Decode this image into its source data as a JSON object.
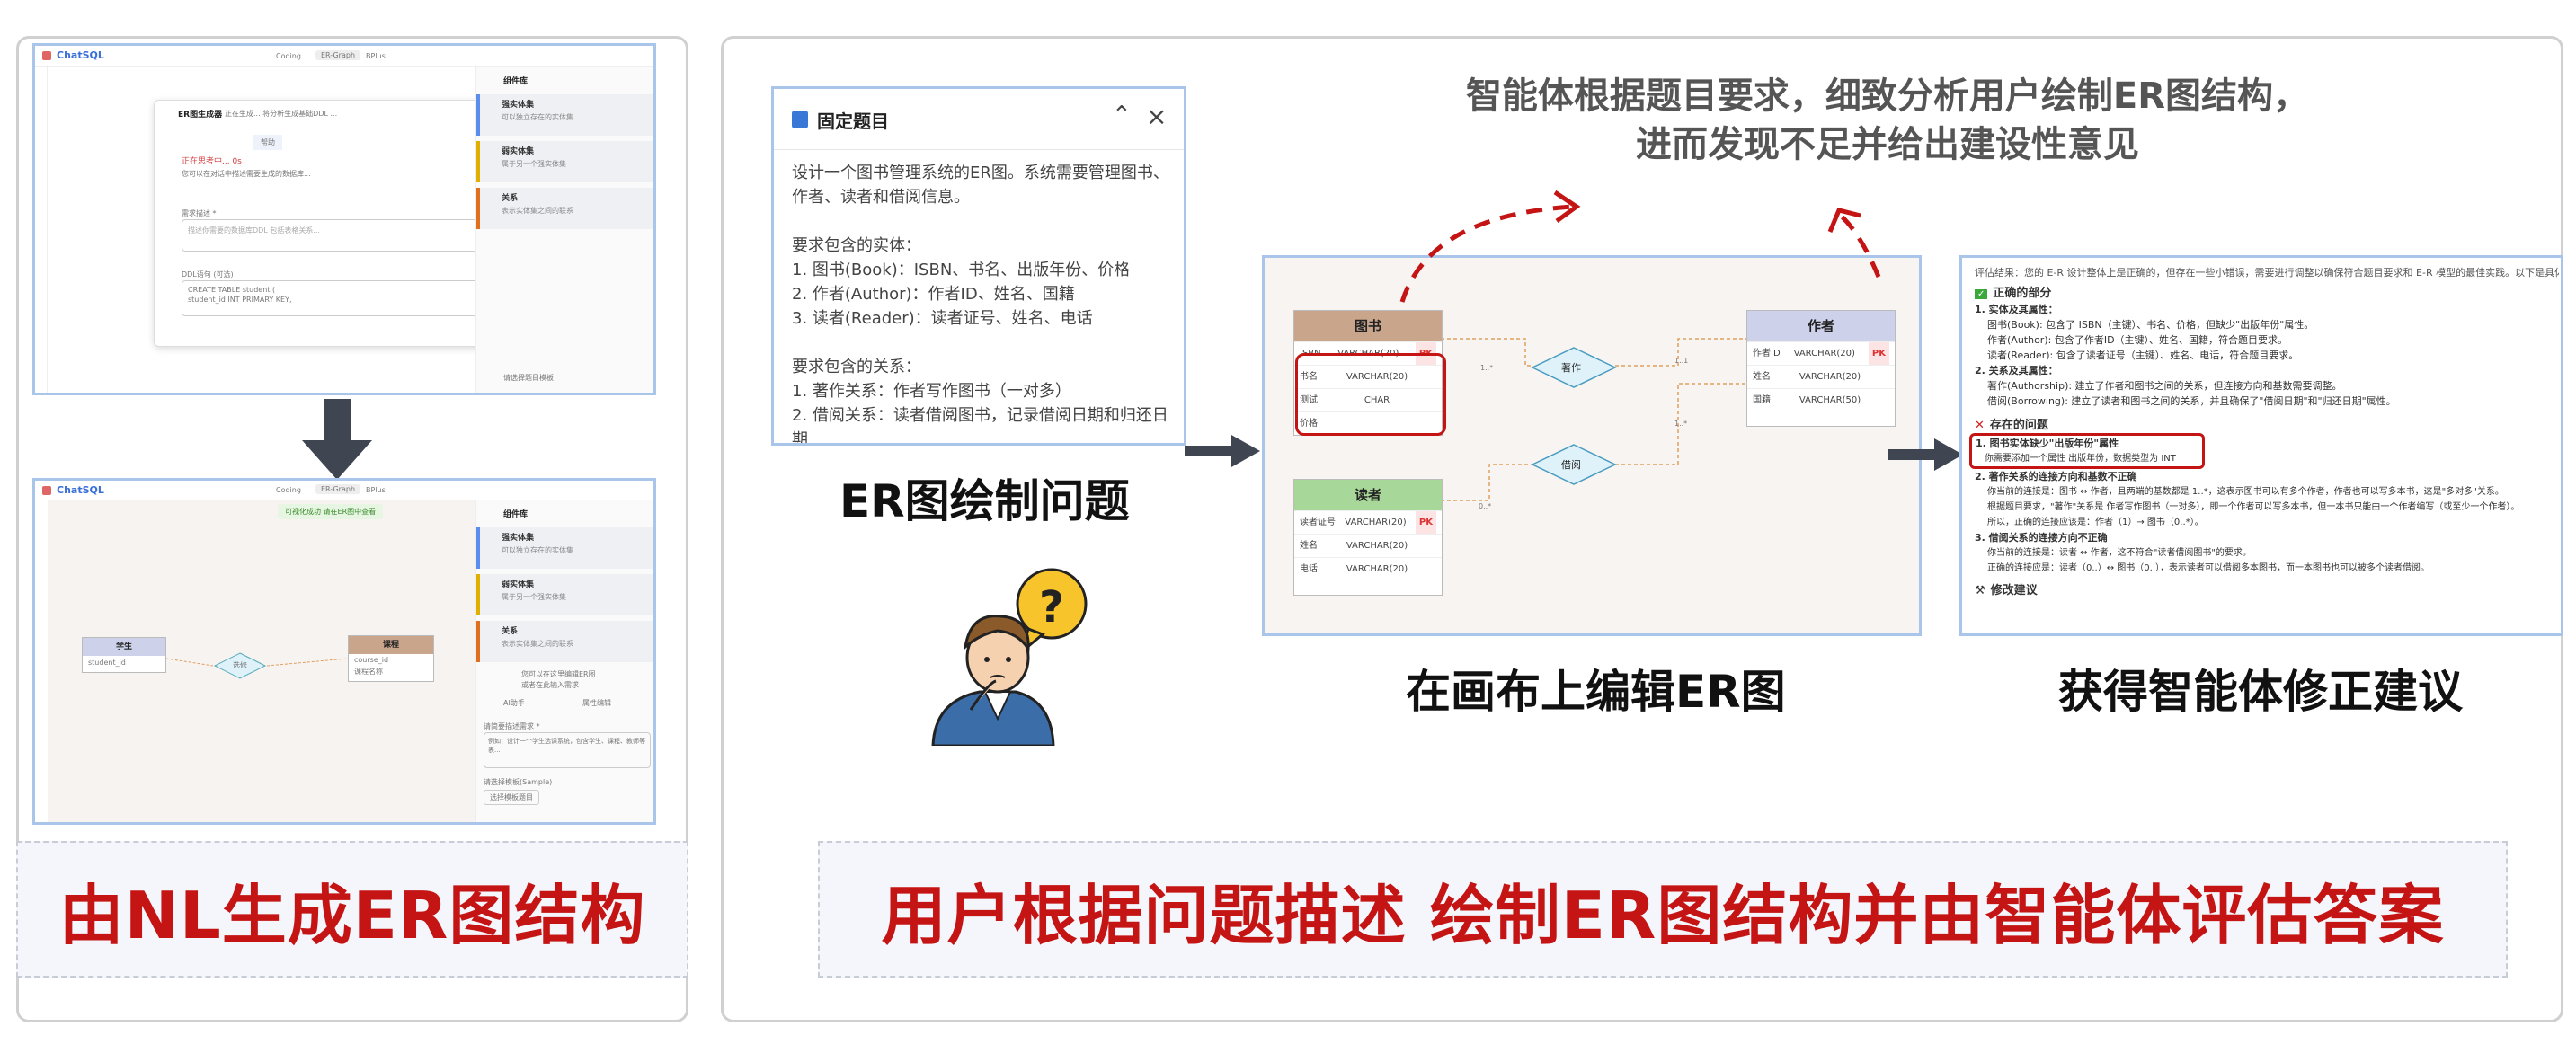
{
  "left_panel": {
    "top_shot": {
      "app_name": "ChatSQL",
      "tabs": [
        "Coding",
        "ER-Graph",
        "BPlus"
      ],
      "dialog_title": "ER图生成器",
      "dialog_sub": "正在生成... 将分析生成基础DDL ...",
      "msg_1": "帮助",
      "status": "正在思考中... 0s",
      "status_sub": "您可以在对话中描述需要生成的数据库...",
      "req_label": "需求描述 *",
      "req_placeholder": "描述你需要的数据库DDL 包括表格关系...",
      "ddl_label": "DDL语句 (可选)",
      "ddl_text": "CREATE TABLE student (",
      "ddl_text2": "  student_id INT PRIMARY KEY,",
      "panel_title": "组件库",
      "side_items": [
        {
          "title": "强实体集",
          "desc": "可以独立存在的实体集"
        },
        {
          "title": "弱实体集",
          "desc": "属于另一个强实体集"
        },
        {
          "title": "关系",
          "desc": "表示实体集之间的联系"
        }
      ],
      "side_bottom": "请选择题目模板"
    },
    "bottom_shot": {
      "app_name": "ChatSQL",
      "tabs": [
        "Coding",
        "ER-Graph",
        "BPlus"
      ],
      "toast": "可视化成功 请在ER图中查看",
      "entity_left": "学生",
      "entity_left_row": "student_id",
      "entity_right": "课程",
      "entity_right_rows": [
        "course_id",
        "课程名称"
      ],
      "relation": "选修",
      "panel_title": "组件库",
      "side_items": [
        {
          "title": "强实体集",
          "desc": "可以独立存在的实体集"
        },
        {
          "title": "弱实体集",
          "desc": "属于另一个强实体集"
        },
        {
          "title": "关系",
          "desc": "表示实体集之间的联系"
        }
      ],
      "hint_1": "您可以在这里编辑ER图",
      "hint_2": "或者在此输入需求",
      "tab_a": "AI助手",
      "tab_b": "属性编辑",
      "req_label": "请简要描述需求 *",
      "req_text": "例如：设计一个学生选课系统，包含学生、课程、教师等表...",
      "example_label": "请选择模板(Sample)",
      "example_btn": "选择模板题目"
    },
    "caption": "由NL生成ER图结构"
  },
  "right_panel": {
    "question_card": {
      "title": "固定题目",
      "paragraph_1": "设计一个图书管理系统的ER图。系统需要管理图书、作者、读者和借阅信息。",
      "entities_header": "要求包含的实体：",
      "entities": [
        "1. 图书(Book)：ISBN、书名、出版年份、价格",
        "2. 作者(Author)：作者ID、姓名、国籍",
        "3. 读者(Reader)：读者证号、姓名、电话"
      ],
      "relations_header": "要求包含的关系：",
      "relations": [
        "1. 著作关系：作者写作图书（一对多）",
        "2. 借阅关系：读者借阅图书，记录借阅日期和归还日期"
      ]
    },
    "question_caption": "ER图绘制问题",
    "canvas": {
      "book": {
        "name": "图书",
        "rows": [
          [
            "ISBN",
            "VARCHAR(20)",
            "PK"
          ],
          [
            "书名",
            "VARCHAR(20)",
            ""
          ],
          [
            "测试",
            "CHAR",
            ""
          ],
          [
            "价格",
            "",
            ""
          ]
        ]
      },
      "author": {
        "name": "作者",
        "rows": [
          [
            "作者ID",
            "VARCHAR(20)",
            "PK"
          ],
          [
            "姓名",
            "VARCHAR(20)",
            ""
          ],
          [
            "国籍",
            "VARCHAR(50)",
            ""
          ]
        ]
      },
      "reader": {
        "name": "读者",
        "rows": [
          [
            "读者证号",
            "VARCHAR(20)",
            "PK"
          ],
          [
            "姓名",
            "VARCHAR(20)",
            ""
          ],
          [
            "电话",
            "VARCHAR(20)",
            ""
          ]
        ]
      },
      "rel_write": "著作",
      "rel_borrow": "借阅",
      "card_1": "1..*",
      "card_2": "1..1",
      "card_3": "0..*",
      "card_4": "1..*"
    },
    "canvas_caption": "在画布上编辑ER图",
    "top_note_line1": "智能体根据题目要求，细致分析用户绘制ER图结构，",
    "top_note_line2": "进而发现不足并给出建设性意见",
    "feedback": {
      "intro": "评估结果：您的 E-R 设计整体上是正确的，但存在一些小错误，需要进行调整以确保符合题目要求和 E-R 模型的最佳实践。以下是具体分析和",
      "correct_header": "正确的部分",
      "c1": "1. 实体及其属性：",
      "c1a": "图书(Book): 包含了 ISBN（主键）、书名、价格，但缺少\"出版年份\"属性。",
      "c1b": "作者(Author): 包含了作者ID（主键）、姓名、国籍，符合题目要求。",
      "c1c": "读者(Reader): 包含了读者证号（主键）、姓名、电话，符合题目要求。",
      "c2": "2. 关系及其属性：",
      "c2a": "著作(Authorship): 建立了作者和图书之间的关系，但连接方向和基数需要调整。",
      "c2b": "借阅(Borrowing): 建立了读者和图书之间的关系，并且确保了\"借阅日期\"和\"归还日期\"属性。",
      "issue_header": "存在的问题",
      "i1": "1. 图书实体缺少\"出版年份\"属性",
      "i1a": "你需要添加一个属性 出版年份，数据类型为 INT",
      "i2": "2. 著作关系的连接方向和基数不正确",
      "i2a": "你当前的连接是：图书 ↔ 作者，且两端的基数都是 1..*，这表示图书可以有多个作者，作者也可以写多本书，这是\"多对多\"关系。",
      "i2b": "根据题目要求，\"著作\"关系是 作者写作图书（一对多），即一个作者可以写多本书，但一本书只能由一个作者编写（或至少一个作者）。",
      "i2c": "所以，正确的连接应该是：作者（1）→ 图书（0..*）。",
      "i3": "3. 借阅关系的连接方向不正确",
      "i3a": "你当前的连接是：读者 ↔ 作者，这不符合\"读者借阅图书\"的要求。",
      "i3b": "正确的连接应是：读者（0..）↔ 图书（0..），表示读者可以借阅多本图书，而一本图书也可以被多个读者借阅。",
      "fix_header": "修改建议"
    },
    "feedback_caption": "获得智能体修正建议",
    "caption": "用户根据问题描述 绘制ER图结构并由智能体评估答案"
  },
  "colors": {
    "caption_red": "#c41414",
    "border_blue": "#a9c6ea",
    "arrow_dark": "#3f4652",
    "annot_red": "#c41414",
    "book_header": "#c9a58b",
    "author_header": "#cdd2ea",
    "reader_header": "#a8d79a",
    "relation_fill": "#dff2fa"
  }
}
